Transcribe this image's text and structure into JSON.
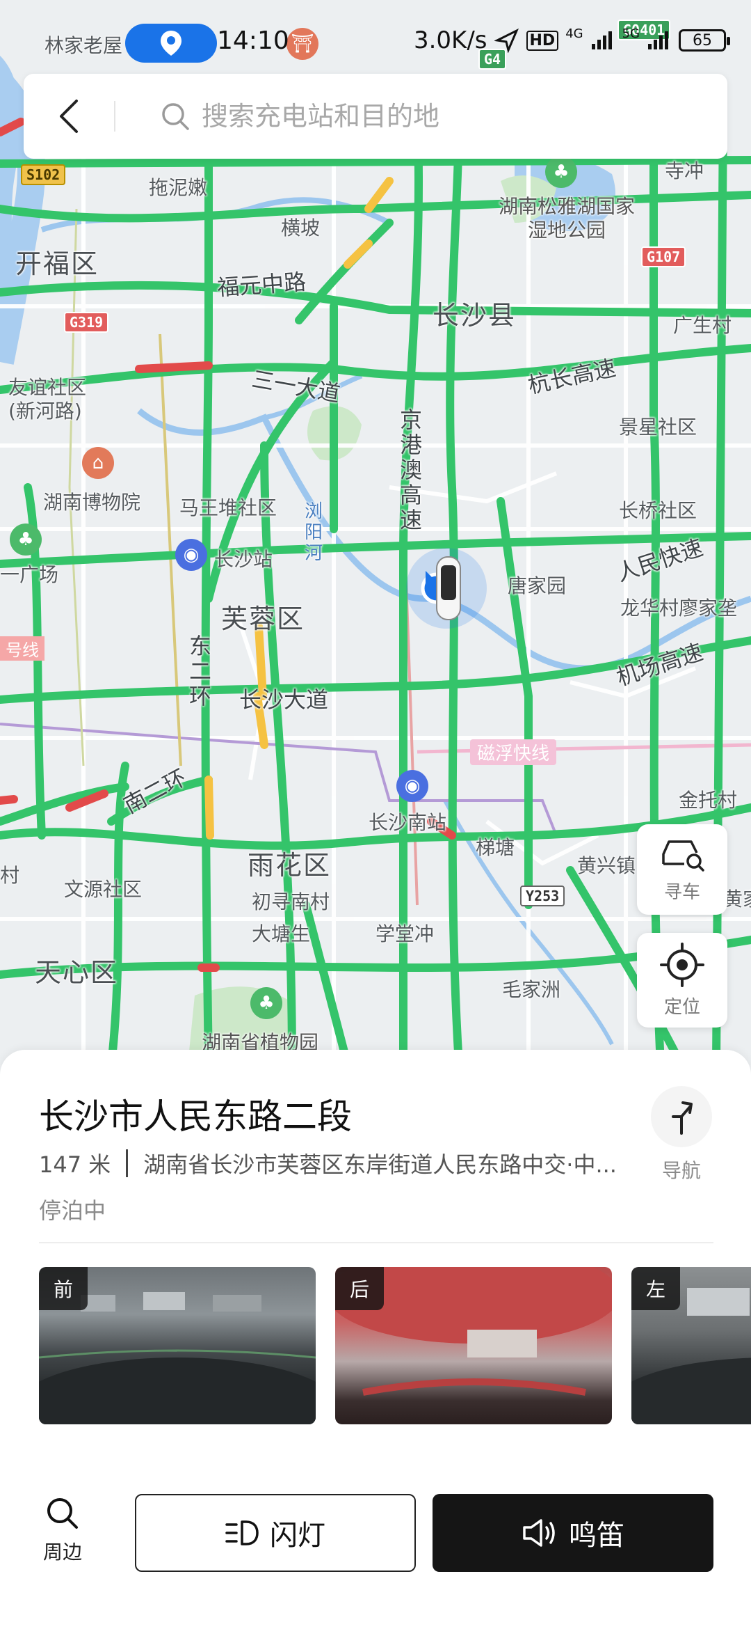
{
  "status_bar": {
    "time": "14:10",
    "net_speed": "3.0K/s",
    "hd_badge": "HD",
    "signal_a": "4G",
    "signal_b": "5G",
    "battery": "65"
  },
  "search": {
    "placeholder": "搜索充电站和目的地"
  },
  "map": {
    "districts": [
      "开福区",
      "长沙县",
      "芙蓉区",
      "雨花区",
      "天心区"
    ],
    "roads": [
      "福元中路",
      "三一大道",
      "杭长高速",
      "京港澳高速",
      "人民快速",
      "长沙大道",
      "机场高速",
      "南二环",
      "东二环"
    ],
    "places": [
      "林家老屋",
      "拖泥嫩",
      "横坡",
      "友谊社区(新河路)",
      "湖南博物院",
      "马王堆社区",
      "长沙站",
      "唐家园",
      "景星社区",
      "长桥社区",
      "龙华村廖家垄",
      "广生村",
      "寺冲",
      "湖南松雅湖国家湿地公园",
      "长沙南站",
      "梯塘",
      "黄兴镇",
      "金托村",
      "文源社区",
      "初寻南村",
      "大塘生",
      "学堂冲",
      "毛家洲",
      "湖南省植物园",
      "浏阳河",
      "磁浮快线",
      "一广场",
      "号线",
      "村",
      "黄家"
    ],
    "shields": [
      "S102",
      "G319",
      "G107",
      "G0401",
      "G4",
      "Y253"
    ]
  },
  "float_buttons": {
    "find_car": "寻车",
    "locate": "定位"
  },
  "place": {
    "title": "长沙市人民东路二段",
    "distance": "147 米",
    "address": "湖南省长沙市芙蓉区东岸街道人民东路中交·中...",
    "status": "停泊中",
    "nav_label": "导航"
  },
  "cameras": [
    {
      "tag": "前"
    },
    {
      "tag": "后"
    },
    {
      "tag": "左"
    }
  ],
  "actions": {
    "nearby": "周边",
    "flash": "闪灯",
    "horn": "鸣笛"
  },
  "colors": {
    "road_green": "#34c46a",
    "water": "#a9cdf0",
    "accent_blue": "#1a73e8",
    "congestion_red": "#e24a4a",
    "slow_yellow": "#f5c242"
  }
}
